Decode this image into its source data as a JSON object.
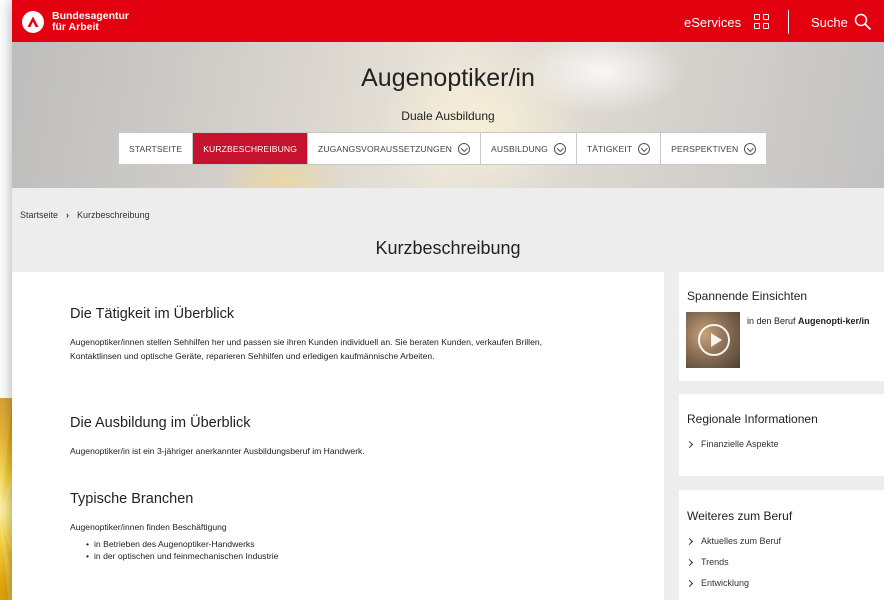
{
  "colors": {
    "brand_red": "#e3000f",
    "active_tab": "#c4122f",
    "background": "#ededed"
  },
  "header": {
    "logo_line1": "Bundesagentur",
    "logo_line2": "für Arbeit",
    "eservices_label": "eServices",
    "eservices_icon": "grid-icon",
    "search_label": "Suche",
    "search_icon": "search-icon"
  },
  "hero": {
    "title": "Augenoptiker/in",
    "subtitle": "Duale Ausbildung"
  },
  "tabs": [
    {
      "label": "STARTSEITE"
    },
    {
      "label": "KURZBESCHREIBUNG"
    },
    {
      "label": "ZUGANGSVORAUSSETZUNGEN"
    },
    {
      "label": "AUSBILDUNG"
    },
    {
      "label": "TÄTIGKEIT"
    },
    {
      "label": "PERSPEKTIVEN"
    }
  ],
  "breadcrumb": {
    "home": "Startseite",
    "current": "Kurzbeschreibung"
  },
  "page_heading": "Kurzbeschreibung",
  "main": {
    "section1": {
      "title": "Die Tätigkeit im Überblick",
      "text": "Augenoptiker/innen stellen Sehhilfen her und passen sie ihren Kunden individuell an. Sie beraten Kunden, verkaufen Brillen, Kontaktlinsen und optische Geräte, reparieren Sehhilfen und erledigen kaufmännische Arbeiten."
    },
    "section2": {
      "title": "Die Ausbildung im Überblick",
      "text": "Augenoptiker/in ist ein 3-jähriger anerkannter Ausbildungsberuf im Handwerk."
    },
    "section3": {
      "title": "Typische Branchen",
      "text": "Augenoptiker/innen finden Beschäftigung",
      "bullets": [
        "in Betrieben des Augenoptiker-Handwerks",
        "in der optischen und feinmechanischen Industrie"
      ]
    }
  },
  "sidebar": {
    "insights": {
      "title": "Spannende Einsichten",
      "text_prefix": "in den Beruf ",
      "text_bold": "Augenopti-ker/in"
    },
    "regional": {
      "title": "Regionale Informationen",
      "links": [
        "Finanzielle Aspekte"
      ]
    },
    "more": {
      "title": "Weiteres zum Beruf",
      "links": [
        "Aktuelles zum Beruf",
        "Trends",
        "Entwicklung"
      ]
    }
  }
}
